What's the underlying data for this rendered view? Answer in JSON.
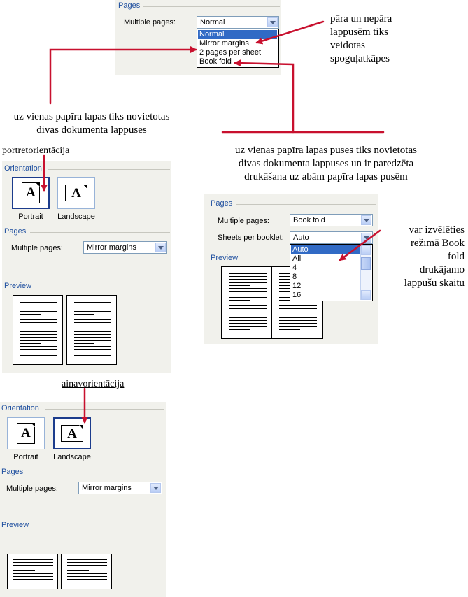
{
  "panel_top": {
    "pages_title": "Pages",
    "multiple_pages_label": "Multiple pages:",
    "combo_value": "Normal",
    "dropdown_items": [
      "Normal",
      "Mirror margins",
      "2 pages per sheet",
      "Book fold"
    ],
    "selected_index": 0
  },
  "panel_portrait": {
    "orientation_title": "Orientation",
    "portrait_label": "Portrait",
    "landscape_label": "Landscape",
    "orientation_glyph": "A",
    "pages_title": "Pages",
    "multiple_pages_label": "Multiple pages:",
    "combo_value": "Mirror margins",
    "preview_title": "Preview",
    "active": "portrait"
  },
  "panel_landscape": {
    "orientation_title": "Orientation",
    "portrait_label": "Portrait",
    "landscape_label": "Landscape",
    "orientation_glyph": "A",
    "pages_title": "Pages",
    "multiple_pages_label": "Multiple pages:",
    "combo_value": "Mirror margins",
    "preview_title": "Preview",
    "active": "landscape"
  },
  "panel_bookfold": {
    "pages_title": "Pages",
    "multiple_pages_label": "Multiple pages:",
    "combo_value": "Book fold",
    "sheets_label": "Sheets per booklet:",
    "sheets_value": "Auto",
    "preview_title": "Preview",
    "dropdown_items": [
      "Auto",
      "All",
      "4",
      "8",
      "12",
      "16"
    ],
    "selected_index": 0
  },
  "annotations": {
    "mirror_note": [
      "pāra un nepāra",
      "lappusēm tiks",
      "veidotas",
      "spoguļatkāpes"
    ],
    "two_pages_note": [
      "uz vienas papīra lapas tiks novietotas",
      "divas dokumenta lappuses"
    ],
    "book_fold_note": [
      "uz vienas papīra lapas puses  tiks novietotas",
      "divas dokumenta lappuses un ir paredzēta",
      "drukāšana uz abām papīra lapas pusēm"
    ],
    "sheets_note": [
      "var izvēlēties",
      "režīmā Book",
      "fold",
      "drukājamo",
      "lappušu skaitu"
    ],
    "portrait_caption": "portretorientācija",
    "landscape_caption": "ainavorientācija"
  },
  "colors": {
    "panel_bg": "#f1f1ec",
    "section_title": "#1f4f9f",
    "selection": "#316ac5",
    "arrow": "#c8102e"
  }
}
